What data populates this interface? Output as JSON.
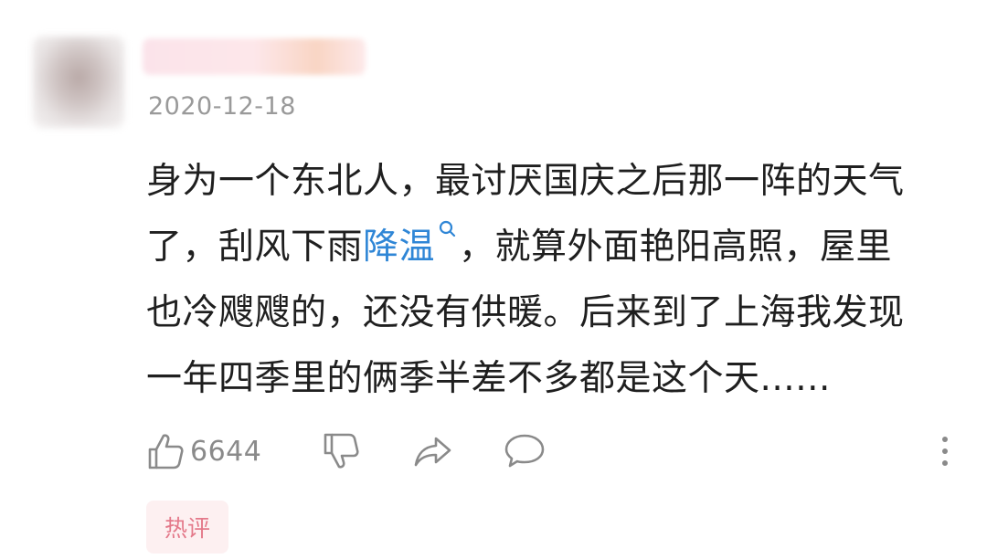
{
  "comment": {
    "date": "2020-12-18",
    "body_lines": [
      "身为一个东北人，最讨厌国庆之后那一阵的天气",
      "，就算外面艳阳高照，屋里",
      "也冷飕飕的，还没有供暖。后来到了上海我发现",
      "一年四季里的俩季半差不多都是这个天......"
    ],
    "line2_prefix": "了，刮风下雨",
    "search_link": "降温",
    "search_link_icon": "search-icon",
    "like_count": "6644",
    "tag": "热评"
  },
  "colors": {
    "link": "#2f86d6",
    "tag_text": "#e4798a",
    "tag_bg": "#fdf0f1",
    "icon_gray": "#8a8a8a"
  }
}
